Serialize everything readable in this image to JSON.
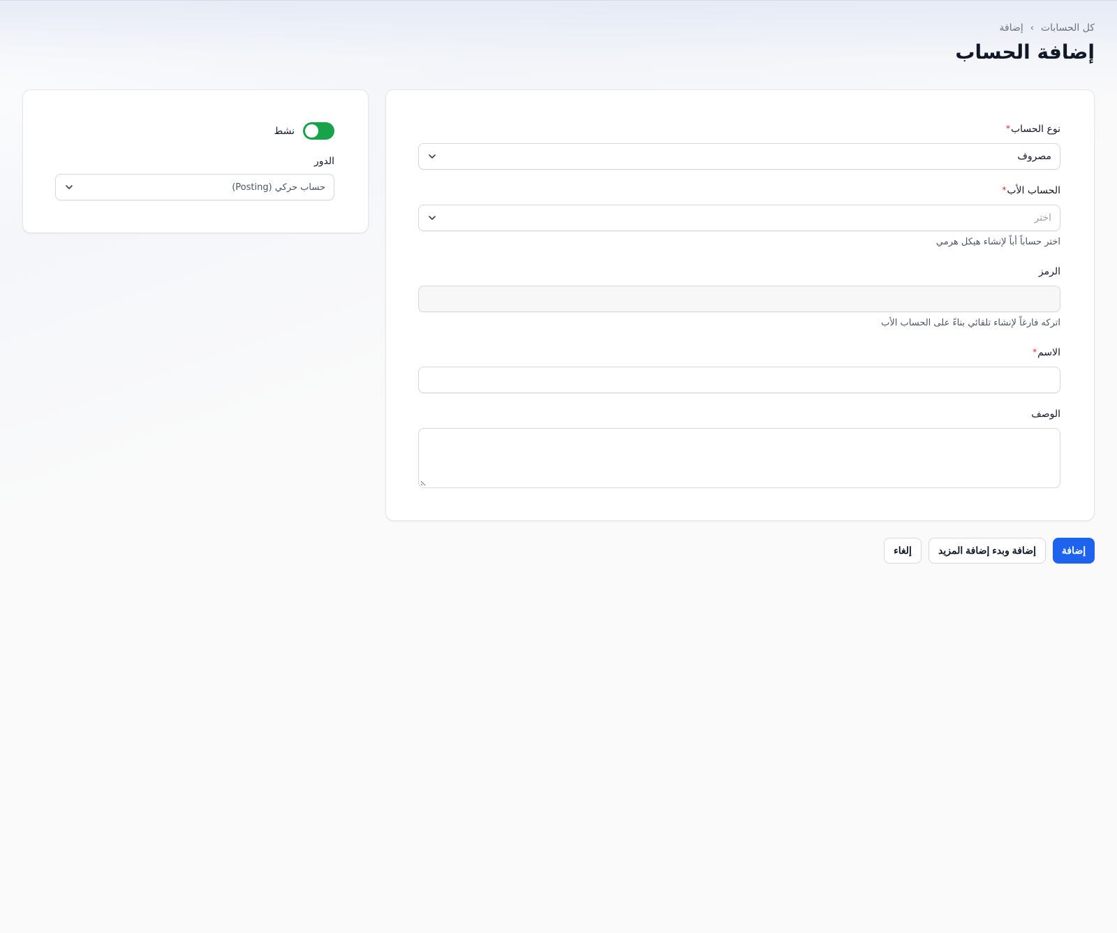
{
  "breadcrumb": {
    "root": "كل الحسابات",
    "current": "إضافة",
    "separator": "›"
  },
  "page": {
    "title": "إضافة الحساب"
  },
  "form": {
    "account_type": {
      "label": "نوع الحساب",
      "required_mark": "*",
      "value": "مصروف"
    },
    "parent_account": {
      "label": "الحساب الأب",
      "required_mark": "*",
      "placeholder": "اختر",
      "helper": "اختر حساباً أباً لإنشاء هيكل هرمي"
    },
    "code": {
      "label": "الرمز",
      "value": "",
      "helper": "اتركه فارغاً لإنشاء تلقائي بناءً على الحساب الأب"
    },
    "name": {
      "label": "الاسم",
      "required_mark": "*",
      "value": ""
    },
    "description": {
      "label": "الوصف",
      "value": ""
    }
  },
  "side": {
    "active": {
      "label": "نشط",
      "on": true
    },
    "role": {
      "label": "الدور",
      "value": "حساب حركي (Posting)"
    }
  },
  "actions": {
    "add": "إضافة",
    "add_and_more": "إضافة وبدء إضافة المزيد",
    "cancel": "إلغاء"
  },
  "colors": {
    "primary": "#1d63ed",
    "toggle_on": "#16a34a",
    "required": "#dc2626"
  }
}
